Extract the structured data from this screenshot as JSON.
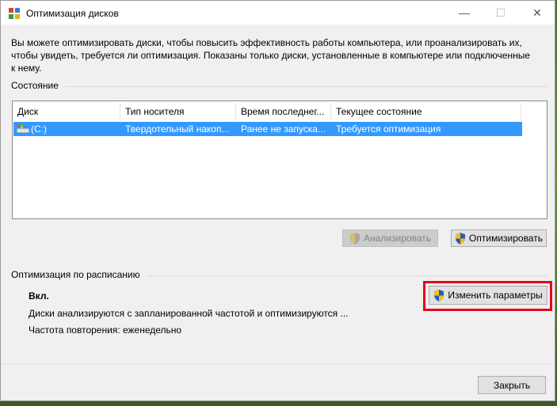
{
  "window": {
    "title": "Оптимизация дисков",
    "controls": {
      "minimize": "—",
      "maximize": "☐",
      "close": "✕"
    }
  },
  "description": "Вы можете оптимизировать диски, чтобы повысить эффективность работы  компьютера, или проанализировать их, чтобы увидеть, требуется ли оптимизация. Показаны только диски, установленные в компьютере или подключенные к нему.",
  "status": {
    "label": "Состояние",
    "columns": [
      "Диск",
      "Тип носителя",
      "Время последнег...",
      "Текущее состояние"
    ],
    "rows": [
      {
        "drive": "(C:)",
        "media_type": "Твердотельный накоп...",
        "last_run": "Ранее не запуска...",
        "state": "Требуется оптимизация",
        "icon": "drive-icon"
      }
    ]
  },
  "buttons": {
    "analyze": "Анализировать",
    "optimize": "Оптимизировать",
    "change_settings": "Изменить параметры",
    "close": "Закрыть"
  },
  "schedule": {
    "label": "Оптимизация по расписанию",
    "status": "Вкл.",
    "details": "Диски анализируются с запланированной частотой и оптимизируются ...",
    "frequency": "Частота повторения: еженедельно"
  },
  "colors": {
    "selection": "#3399ff",
    "highlight": "#e8001c"
  }
}
